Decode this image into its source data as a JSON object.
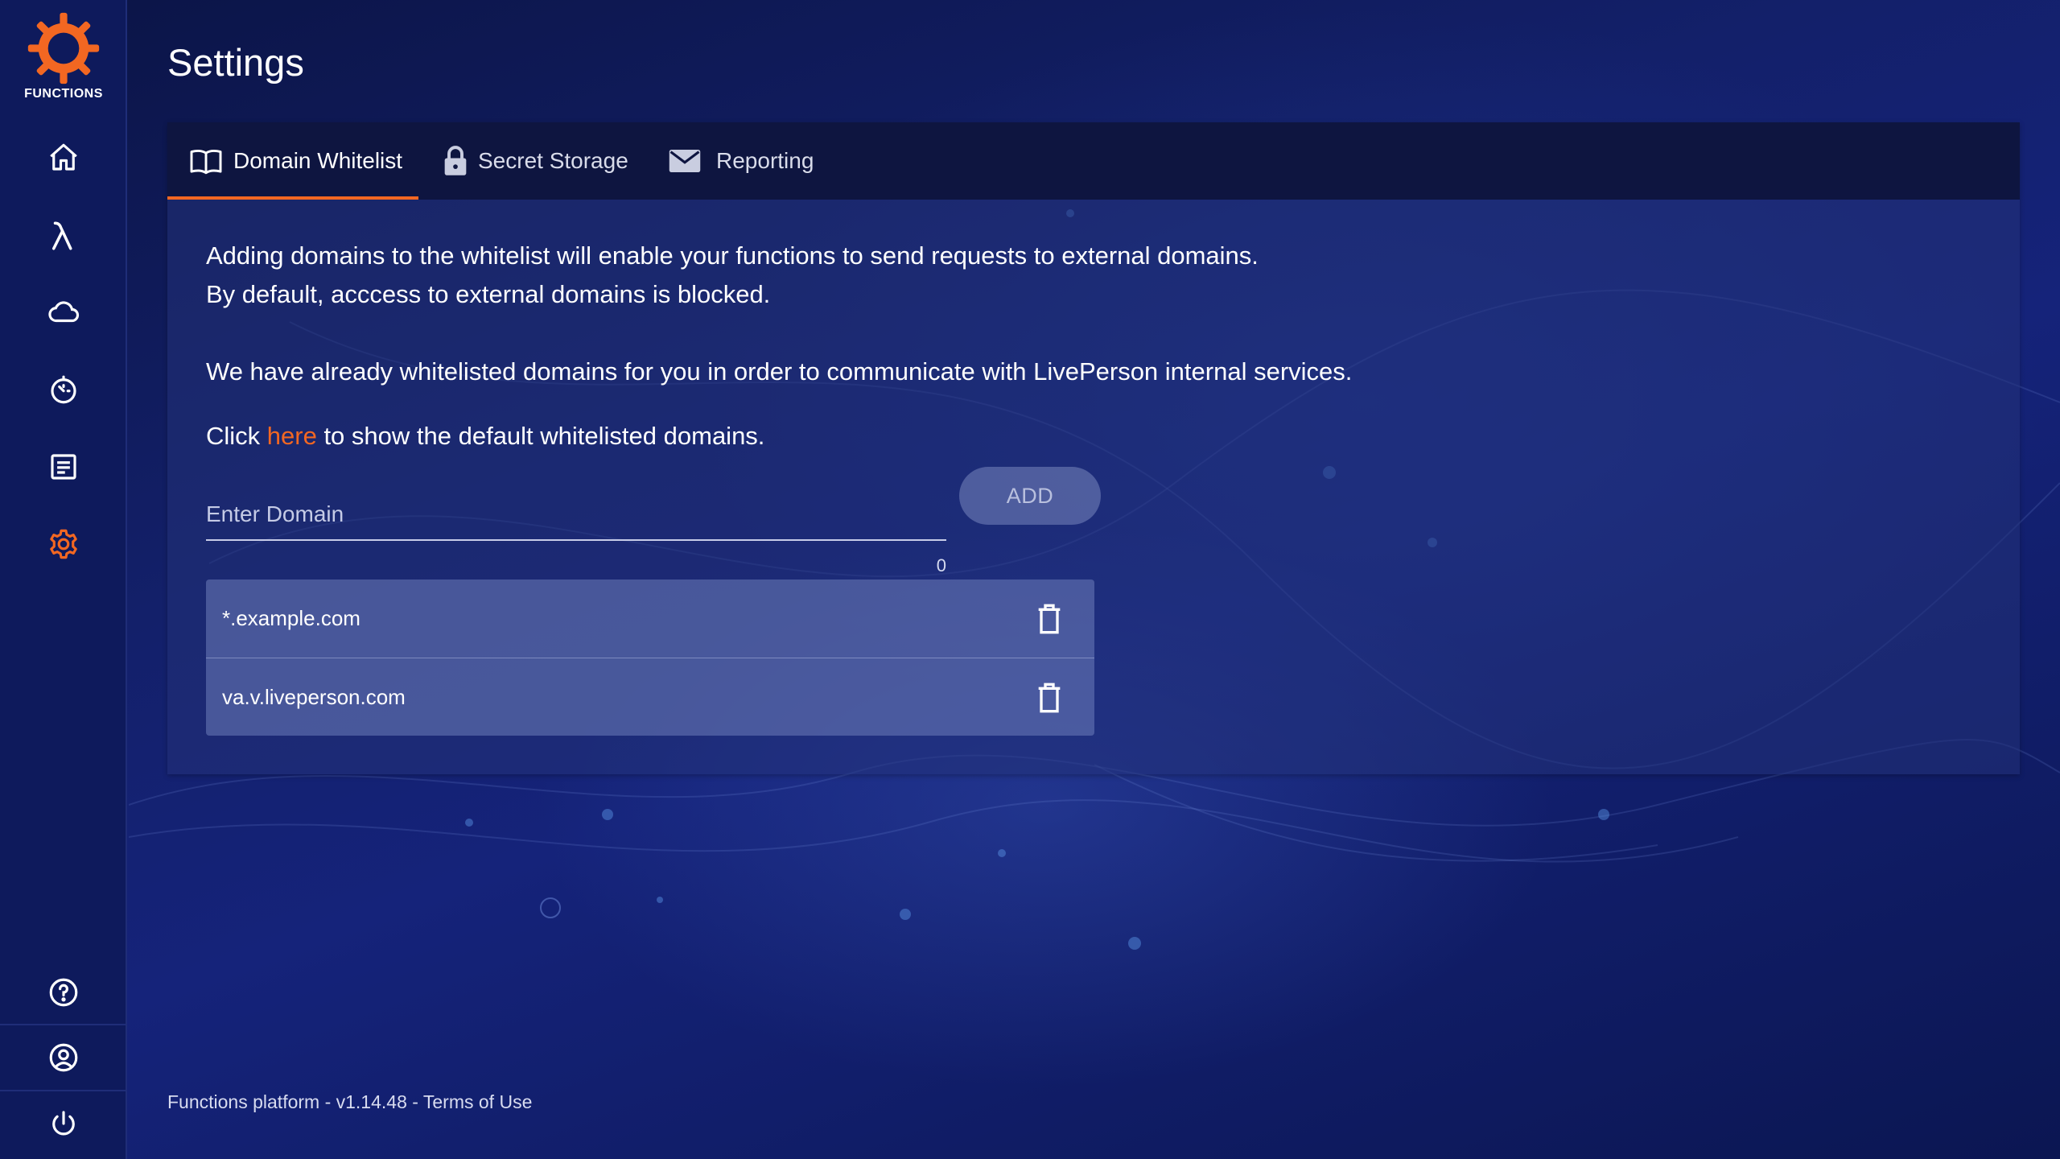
{
  "app": {
    "logo_text": "FUNCTIONS",
    "accent_color": "#f26722"
  },
  "sidebar": {
    "items": [
      {
        "name": "home",
        "icon": "home-icon"
      },
      {
        "name": "functions",
        "icon": "lambda-icon"
      },
      {
        "name": "deployments",
        "icon": "cloud-icon"
      },
      {
        "name": "schedules",
        "icon": "timer-icon"
      },
      {
        "name": "logs",
        "icon": "document-icon"
      },
      {
        "name": "settings",
        "icon": "gear-icon",
        "active": true
      }
    ],
    "bottom_items": [
      {
        "name": "help",
        "icon": "help-circle-icon"
      },
      {
        "name": "account",
        "icon": "user-circle-icon"
      },
      {
        "name": "logout",
        "icon": "power-icon"
      }
    ]
  },
  "page": {
    "title": "Settings"
  },
  "tabs": [
    {
      "label": "Domain Whitelist",
      "icon": "book-icon",
      "active": true
    },
    {
      "label": "Secret Storage",
      "icon": "lock-icon",
      "active": false
    },
    {
      "label": "Reporting",
      "icon": "mail-icon",
      "active": false
    }
  ],
  "whitelist": {
    "intro_line1": "Adding domains to the whitelist will enable your functions to send requests to external domains.",
    "intro_line2": "By default, acccess to external domains is blocked.",
    "intro_line3": "We have already whitelisted domains for you in order to communicate with LivePerson internal services.",
    "click_prefix": "Click ",
    "click_link": "here",
    "click_suffix": " to show the default whitelisted domains.",
    "input_placeholder": "Enter Domain",
    "input_value": "",
    "char_count": "0",
    "add_label": "ADD",
    "domains": [
      "*.example.com",
      "va.v.liveperson.com"
    ]
  },
  "footer": {
    "platform_text": "Functions platform - v1.14.48 - ",
    "terms_label": "Terms of Use"
  }
}
